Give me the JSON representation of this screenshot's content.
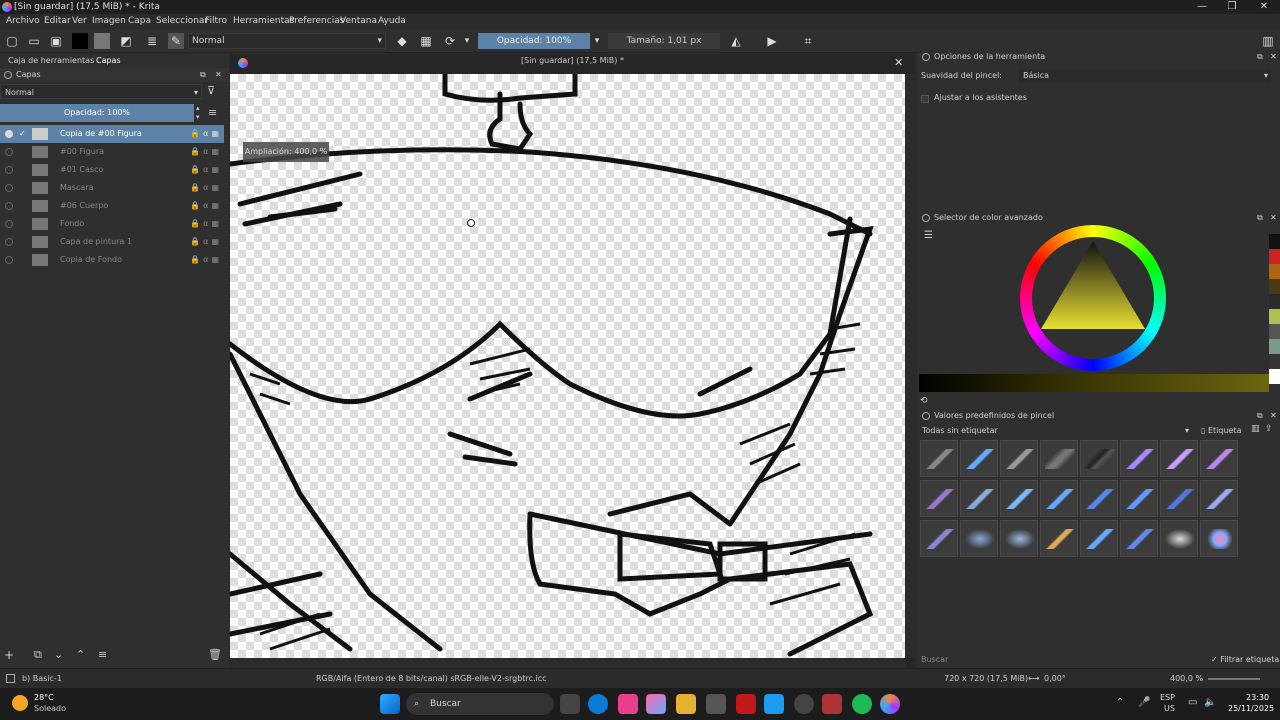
{
  "window": {
    "title": "[Sin guardar]  (17,5 MiB) * - Krita",
    "minimize": "—",
    "restore": "❐",
    "close": "✕"
  },
  "menu": [
    "Archivo",
    "Editar",
    "Ver",
    "Imagen",
    "Capa",
    "Seleccionar",
    "Filtro",
    "Herramientas",
    "Preferencias",
    "Ventana",
    "Ayuda"
  ],
  "toolbar": {
    "blend_mode": "Normal",
    "opacity": "Opacidad: 100%",
    "size": "Tamaño: 1,01 px"
  },
  "left_panel": {
    "tabs": [
      "Caja de herramientas",
      "Capas"
    ],
    "header": "Capas",
    "blend_mode": "Normal",
    "opacity": "Opacidad:  100%",
    "layers": [
      {
        "name": "Copia de #00 Figura",
        "selected": true
      },
      {
        "name": "#00 Figura",
        "selected": false
      },
      {
        "name": "#01 Casco",
        "selected": false
      },
      {
        "name": "Mascara",
        "selected": false
      },
      {
        "name": "#06 Cuerpo",
        "selected": false
      },
      {
        "name": "Fondo",
        "selected": false
      },
      {
        "name": "Capa de pintura 1",
        "selected": false
      },
      {
        "name": "Copia de Fondo",
        "selected": false
      }
    ]
  },
  "canvas": {
    "document_title": "[Sin guardar]  (17,5 MiB) *",
    "zoom_label": "Ampliación: 400,0 %"
  },
  "right_panel": {
    "tool_options": {
      "header": "Opciones de la herramienta",
      "smoothing_label": "Suavidad del pincel:",
      "smoothing_value": "Básica",
      "assistants": "Ajustar a los asistentes"
    },
    "color_selector": {
      "header": "Selector de color avanzado",
      "swatches": [
        "#111111",
        "#cc2222",
        "#aa6611",
        "#4a3a10",
        "#2a2a2a",
        "#b0c050",
        "#555555",
        "#7a9a8a",
        "#333333",
        "#ffffff"
      ]
    },
    "brush_presets": {
      "header": "Valores predefinidos de pincel",
      "filter": "Todas sin etiquetar",
      "tag": "Etiqueta",
      "search_placeholder": "Buscar",
      "filter_tag": "Filtrar etiqueta"
    }
  },
  "statusbar": {
    "brush": "b) Basic-1",
    "color_info": "RGB/Alfa (Entero de 8 bits/canal)  sRGB-elle-V2-srgbtrc.icc",
    "dimensions": "720 x 720 (17,5 MiB)",
    "rotation": "0,00°",
    "zoom": "400,0 %"
  },
  "taskbar": {
    "weather_temp": "28°C",
    "weather_text": "Soleado",
    "search": "Buscar",
    "lang": "ESP",
    "lang2": "US",
    "time": "23:30",
    "date": "25/11/2025"
  }
}
